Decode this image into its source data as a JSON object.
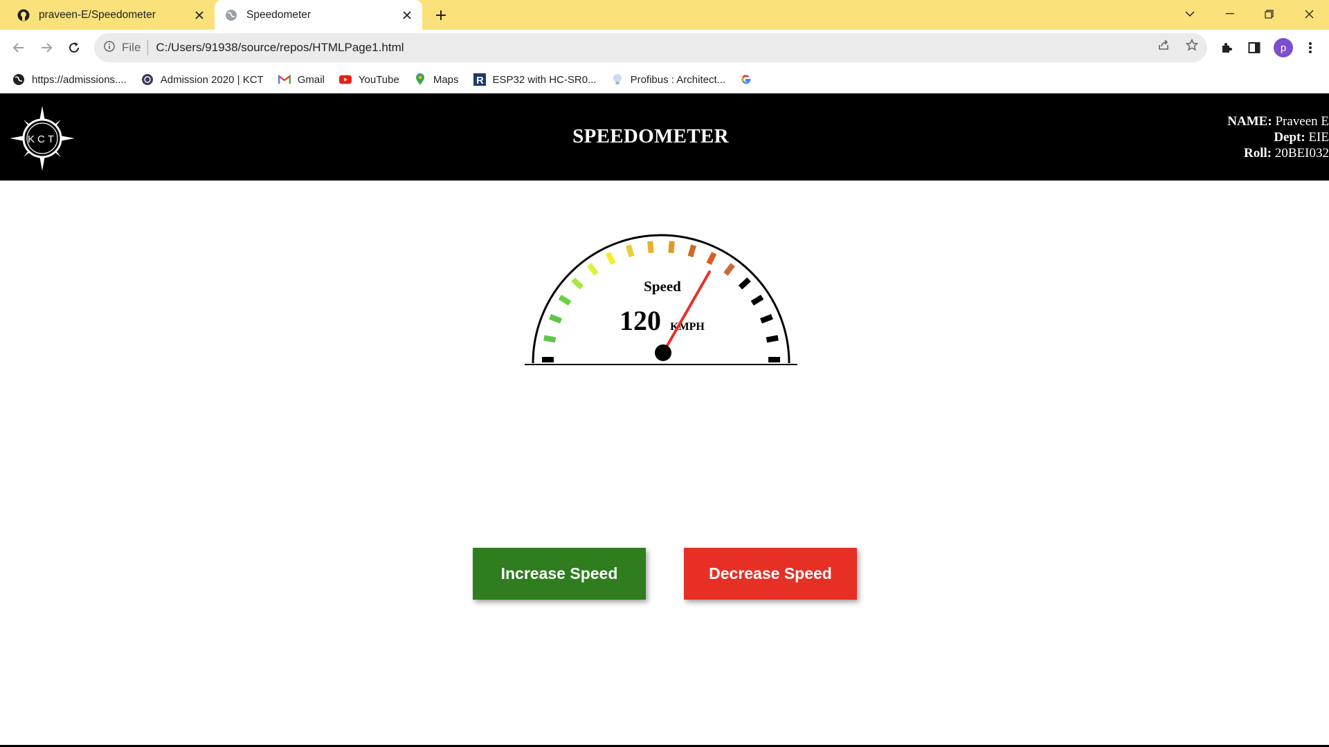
{
  "browser": {
    "tabs": [
      {
        "title": "praveen-E/Speedometer",
        "active": false,
        "icon": "github-icon"
      },
      {
        "title": "Speedometer",
        "active": true,
        "icon": "globe-icon"
      }
    ],
    "address": {
      "scheme_label": "File",
      "url": "C:/Users/91938/source/repos/HTMLPage1.html"
    },
    "avatar_letter": "p",
    "bookmarks": [
      {
        "label": "https://admissions....",
        "icon": "globe-icon"
      },
      {
        "label": "Admission 2020 | KCT",
        "icon": "kct-icon"
      },
      {
        "label": "Gmail",
        "icon": "gmail-icon"
      },
      {
        "label": "YouTube",
        "icon": "youtube-icon"
      },
      {
        "label": "Maps",
        "icon": "maps-icon"
      },
      {
        "label": "ESP32 with HC-SR0...",
        "icon": "r-icon"
      },
      {
        "label": "Profibus : Architect...",
        "icon": "bulb-icon"
      },
      {
        "label": "",
        "icon": "google-icon"
      }
    ]
  },
  "page": {
    "logo_text": "KCT",
    "title": "SPEEDOMETER",
    "student": {
      "name_label": "NAME:",
      "name": "Praveen E",
      "dept_label": "Dept:",
      "dept": "EIE",
      "roll_label": "Roll:",
      "roll": "20BEI032"
    },
    "gauge": {
      "label": "Speed",
      "value": "120",
      "unit": "KMPH",
      "needle_color": "#e8302a"
    },
    "buttons": {
      "increase": "Increase Speed",
      "decrease": "Decrease Speed"
    },
    "colors": {
      "header_bg": "#000000",
      "tabstrip_bg": "#fbe17a",
      "increase_bg": "#2f7d1f",
      "decrease_bg": "#e63026"
    }
  }
}
